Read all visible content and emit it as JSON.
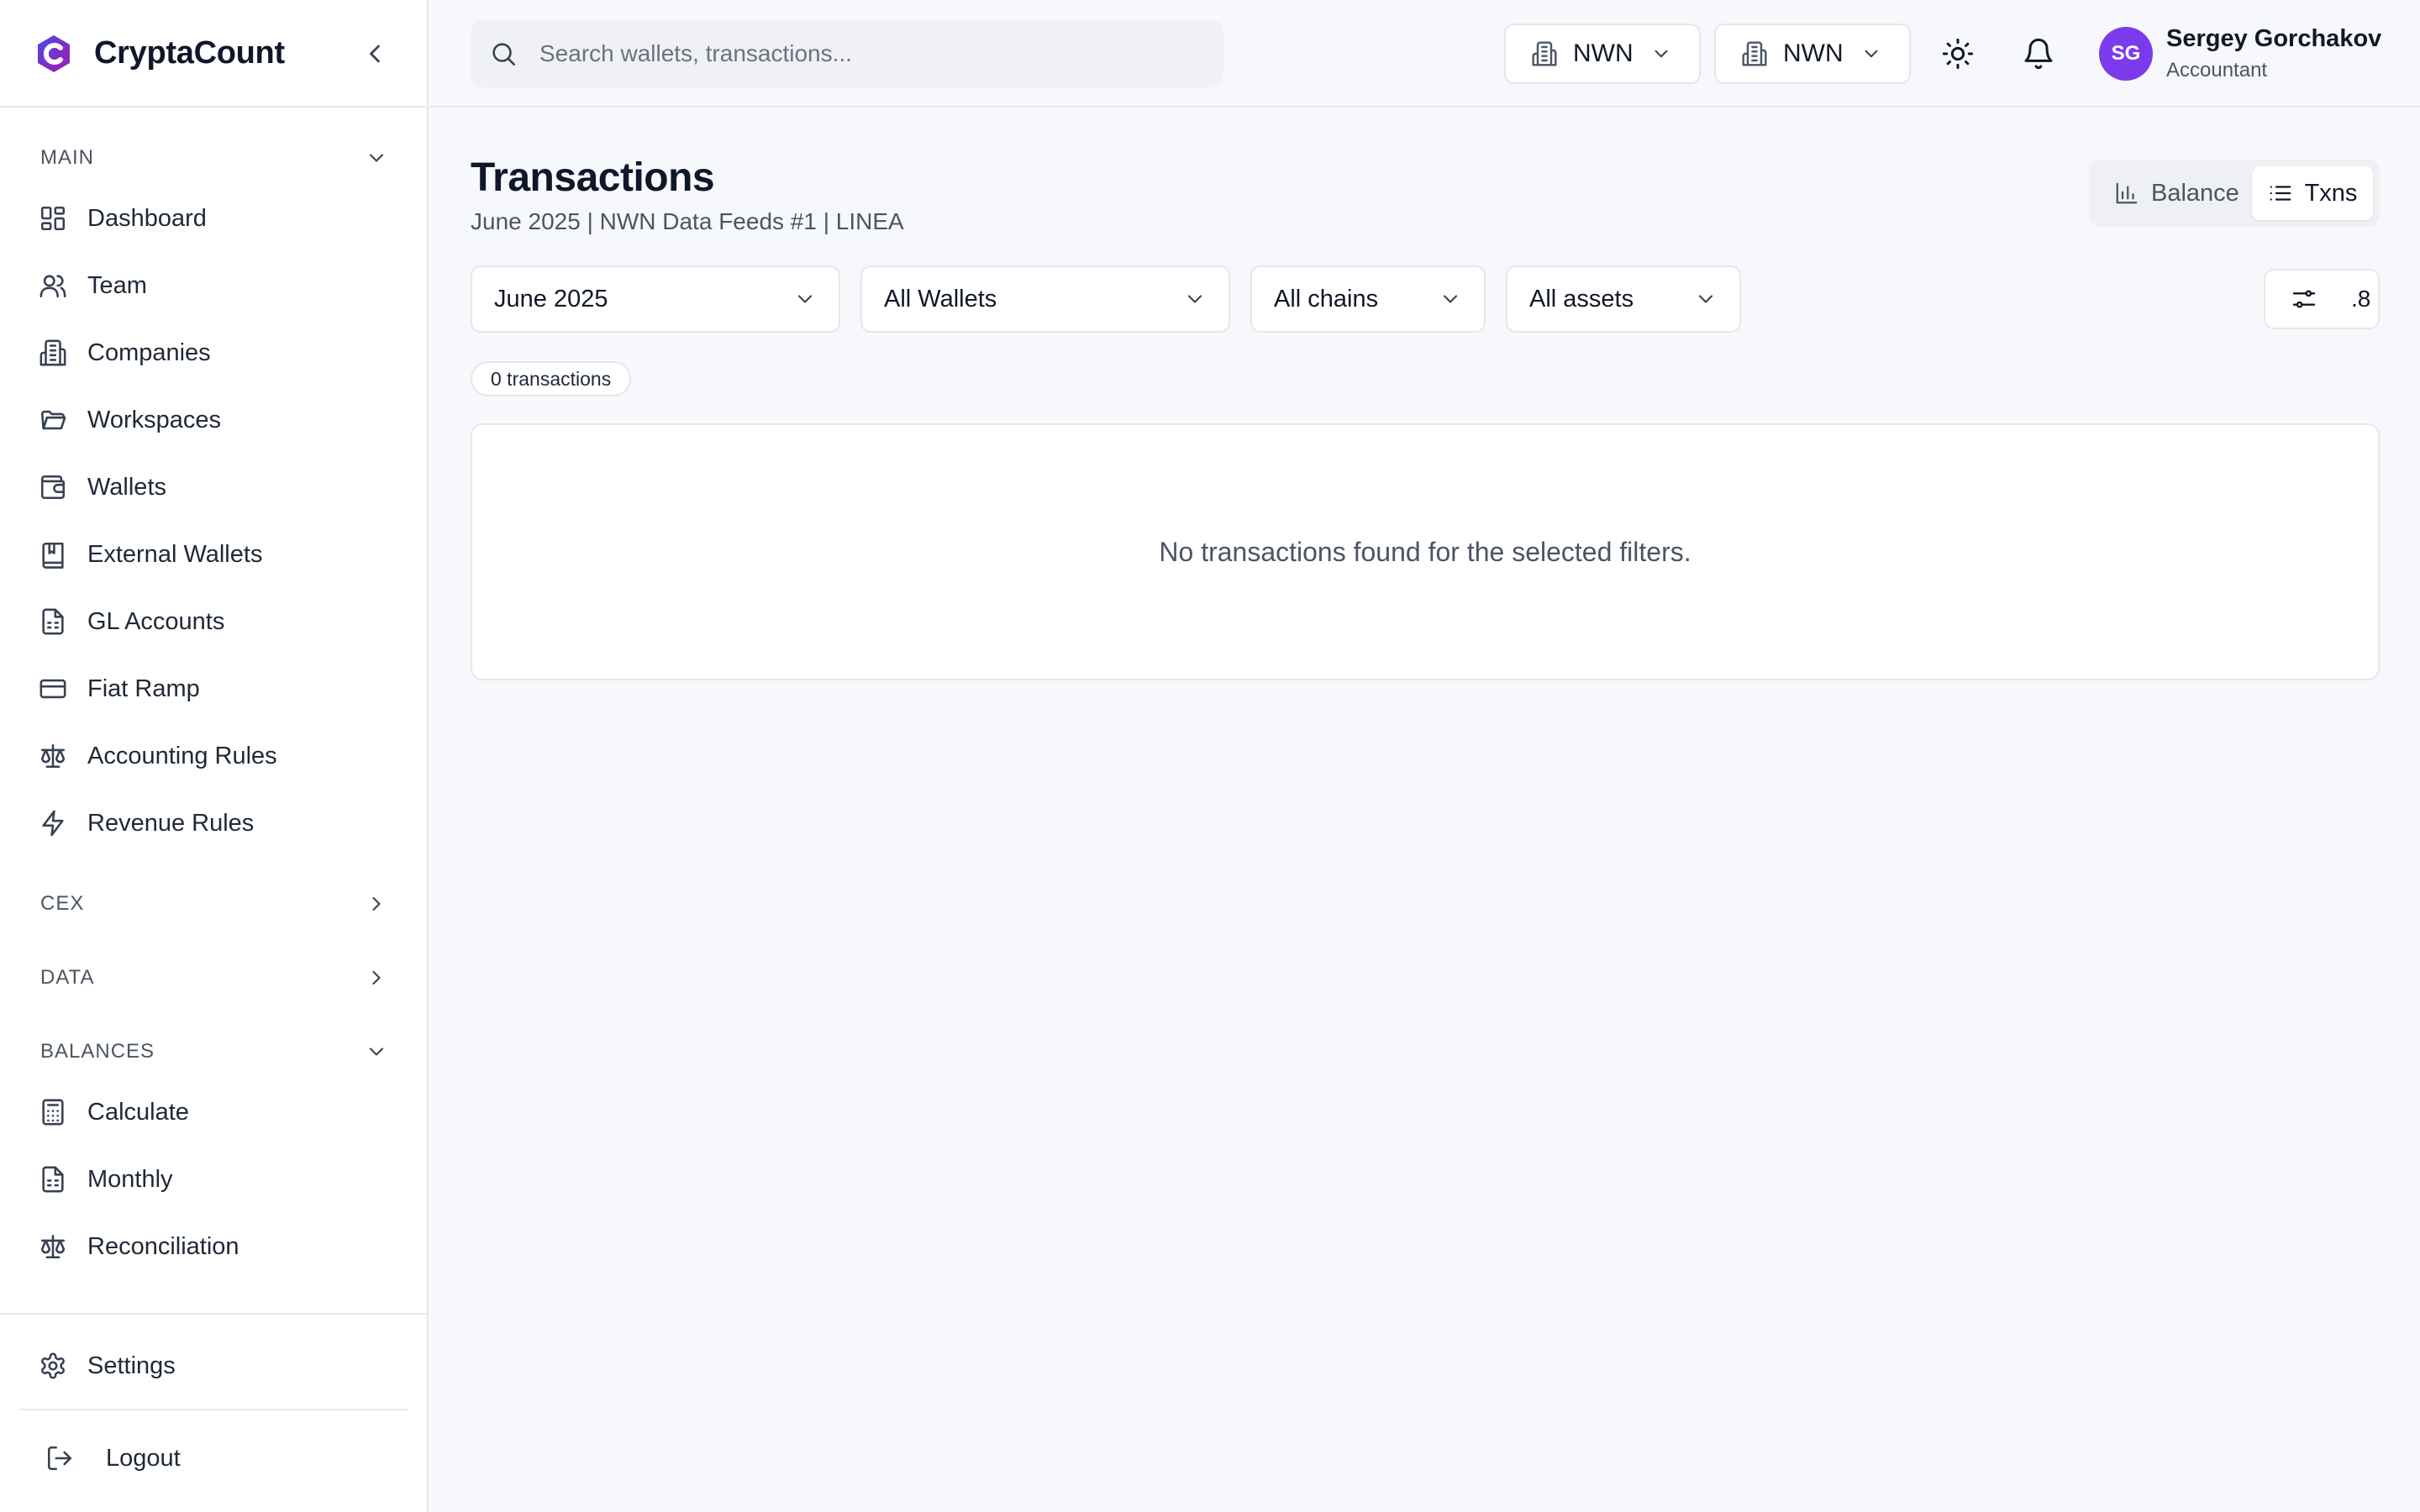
{
  "app": {
    "name": "CryptaCount",
    "accent": "#7c3aed"
  },
  "search": {
    "placeholder": "Search wallets, transactions..."
  },
  "header": {
    "org_selects": [
      {
        "label": "NWN"
      },
      {
        "label": "NWN"
      }
    ],
    "user": {
      "initials": "SG",
      "name": "Sergey Gorchakov",
      "role": "Accountant"
    }
  },
  "sidebar": {
    "sections": {
      "main": "MAIN",
      "cex": "CEX",
      "data": "DATA",
      "balances": "BALANCES"
    },
    "main_items": [
      {
        "label": "Dashboard",
        "icon": "dashboard-icon"
      },
      {
        "label": "Team",
        "icon": "users-icon"
      },
      {
        "label": "Companies",
        "icon": "building-icon"
      },
      {
        "label": "Workspaces",
        "icon": "folder-icon"
      },
      {
        "label": "Wallets",
        "icon": "wallet-icon"
      },
      {
        "label": "External Wallets",
        "icon": "book-icon"
      },
      {
        "label": "GL Accounts",
        "icon": "file-spreadsheet-icon"
      },
      {
        "label": "Fiat Ramp",
        "icon": "credit-card-icon"
      },
      {
        "label": "Accounting Rules",
        "icon": "scale-icon"
      },
      {
        "label": "Revenue Rules",
        "icon": "zap-icon"
      }
    ],
    "balances_items": [
      {
        "label": "Calculate",
        "icon": "calculator-icon"
      },
      {
        "label": "Monthly",
        "icon": "file-spreadsheet-icon"
      },
      {
        "label": "Reconciliation",
        "icon": "scale-icon"
      }
    ],
    "settings": "Settings",
    "logout": "Logout"
  },
  "main": {
    "title": "Transactions",
    "subtitle": "June 2025 | NWN Data Feeds #1 | LINEA",
    "view_toggle": {
      "balance": "Balance",
      "txns": "Txns",
      "active": "txns"
    },
    "filters": {
      "period": "June 2025",
      "wallets": "All Wallets",
      "chains": "All chains",
      "assets": "All assets"
    },
    "filter_settings_value": ".8",
    "count": "0 transactions",
    "empty_message": "No transactions found for the selected filters."
  }
}
